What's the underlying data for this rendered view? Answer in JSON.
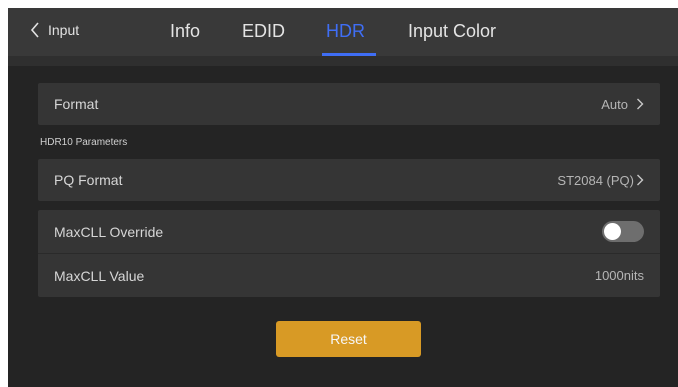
{
  "header": {
    "back_label": "Input",
    "tabs": [
      {
        "label": "Info"
      },
      {
        "label": "EDID"
      },
      {
        "label": "HDR"
      },
      {
        "label": "Input Color"
      }
    ],
    "active_tab": "HDR",
    "accent_color": "#3f6ef5"
  },
  "settings": {
    "format": {
      "label": "Format",
      "value": "Auto",
      "icon": "chevron-right-icon"
    },
    "section_title": "HDR10 Parameters",
    "pq_format": {
      "label": "PQ Format",
      "value": "ST2084 (PQ)",
      "icon": "chevron-right-icon"
    },
    "maxcll_override": {
      "label": "MaxCLL Override",
      "enabled": false
    },
    "maxcll_value": {
      "label": "MaxCLL Value",
      "value": "1000nits"
    }
  },
  "actions": {
    "reset_label": "Reset",
    "reset_color": "#d89a25"
  }
}
